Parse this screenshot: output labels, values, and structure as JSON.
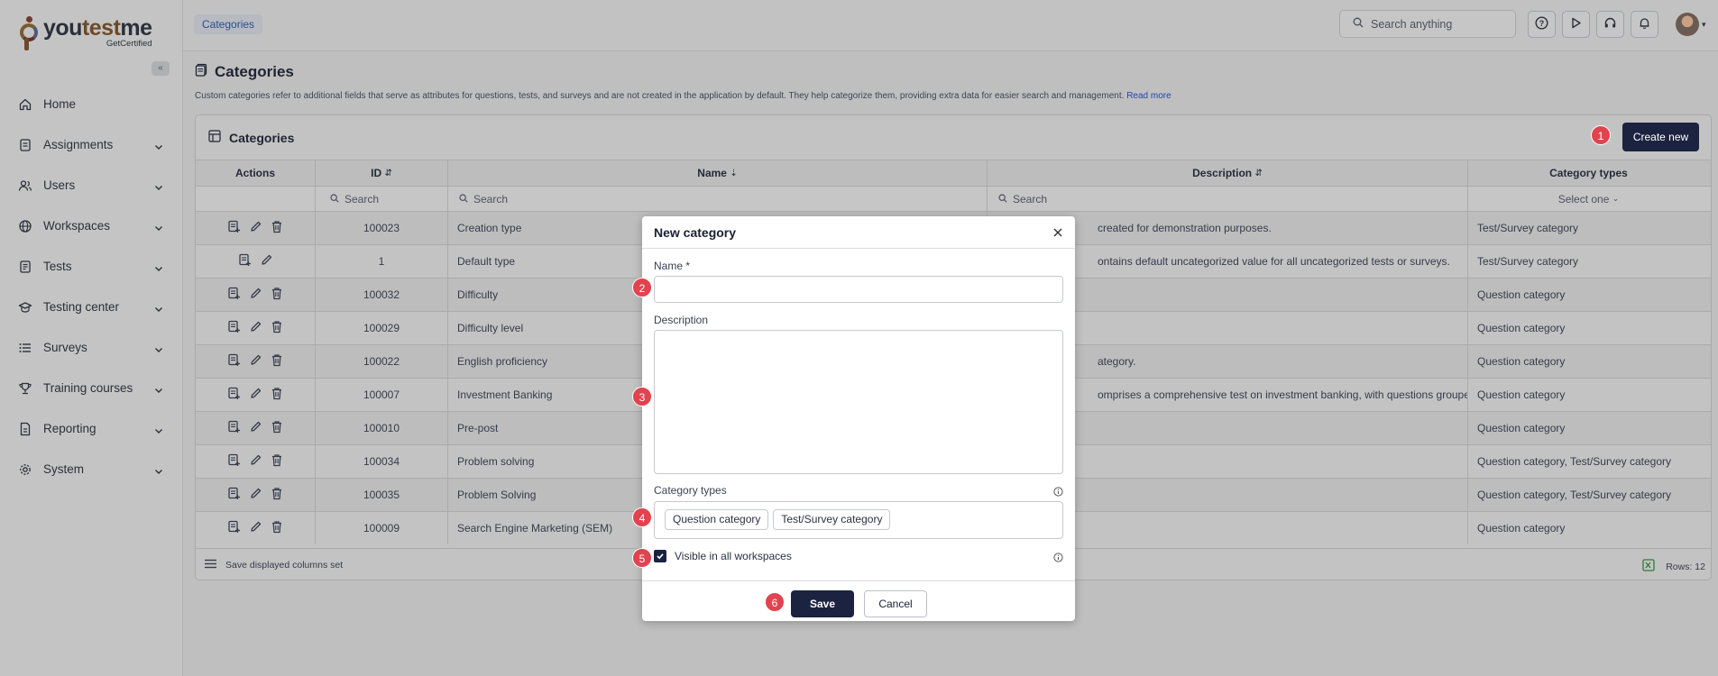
{
  "brand": {
    "name_you": "you",
    "name_test": "test",
    "name_me": "me",
    "tagline": "GetCertified",
    "collapse_glyph": "«"
  },
  "sidebar": {
    "items": [
      {
        "label": "Home",
        "icon": "home-icon",
        "expandable": false
      },
      {
        "label": "Assignments",
        "icon": "clipboard-icon",
        "expandable": true
      },
      {
        "label": "Users",
        "icon": "users-icon",
        "expandable": true
      },
      {
        "label": "Workspaces",
        "icon": "globe-icon",
        "expandable": true
      },
      {
        "label": "Tests",
        "icon": "test-icon",
        "expandable": true
      },
      {
        "label": "Testing center",
        "icon": "graduation-cap-icon",
        "expandable": true
      },
      {
        "label": "Surveys",
        "icon": "list-icon",
        "expandable": true
      },
      {
        "label": "Training courses",
        "icon": "trophy-icon",
        "expandable": true
      },
      {
        "label": "Reporting",
        "icon": "report-icon",
        "expandable": true
      },
      {
        "label": "System",
        "icon": "gear-icon",
        "expandable": true
      }
    ]
  },
  "topbar": {
    "breadcrumb": "Categories",
    "search_placeholder": "Search anything",
    "icons": [
      "help-icon",
      "play-icon",
      "headset-icon",
      "bell-icon"
    ]
  },
  "page": {
    "title": "Categories",
    "description": "Custom categories refer to additional fields that serve as attributes for questions, tests, and surveys and are not created in the application by default. They help categorize them, providing extra data for easier search and management.",
    "read_more": "Read more"
  },
  "card": {
    "title": "Categories",
    "create_button": "Create new",
    "columns": {
      "actions": "Actions",
      "id": "ID",
      "name": "Name",
      "description": "Description",
      "types": "Category types"
    },
    "filters": {
      "id": "Search",
      "name": "Search",
      "description": "Search",
      "types": "Select one"
    },
    "rows": [
      {
        "id": "100023",
        "name": "Creation type",
        "description": "created for demonstration purposes.",
        "desc_indent": "28",
        "types": "Test/Survey category",
        "delete": true
      },
      {
        "id": "1",
        "name": "Default type",
        "description": "ontains default uncategorized value for all uncategorized tests or surveys.",
        "desc_indent": "28",
        "types": "Test/Survey category",
        "delete": false
      },
      {
        "id": "100032",
        "name": "Difficulty",
        "description": "",
        "desc_indent": "0",
        "types": "Question category",
        "delete": true
      },
      {
        "id": "100029",
        "name": "Difficulty level",
        "description": "",
        "desc_indent": "0",
        "types": "Question category",
        "delete": true
      },
      {
        "id": "100022",
        "name": "English proficiency",
        "description": "ategory.",
        "desc_indent": "28",
        "types": "Question category",
        "delete": true
      },
      {
        "id": "100007",
        "name": "Investment Banking",
        "description": "omprises a comprehensive test on investment banking, with questions groupe...",
        "desc_indent": "28",
        "types": "Question category",
        "delete": true
      },
      {
        "id": "100010",
        "name": "Pre-post",
        "description": "",
        "desc_indent": "0",
        "types": "Question category",
        "delete": true
      },
      {
        "id": "100034",
        "name": "Problem solving",
        "description": "",
        "desc_indent": "0",
        "types": "Question category, Test/Survey category",
        "delete": true
      },
      {
        "id": "100035",
        "name": "Problem Solving",
        "description": "",
        "desc_indent": "0",
        "types": "Question category, Test/Survey category",
        "delete": true
      },
      {
        "id": "100009",
        "name": "Search Engine Marketing (SEM)",
        "description": "",
        "desc_indent": "0",
        "types": "Question category",
        "delete": true
      }
    ],
    "footer_label": "Save displayed columns set",
    "rows_count": "Rows: 12"
  },
  "modal": {
    "title": "New category",
    "name_label": "Name",
    "required_mark": "*",
    "name_value": "",
    "description_label": "Description",
    "description_value": "",
    "types_label": "Category types",
    "type_chips": [
      "Question category",
      "Test/Survey category"
    ],
    "visible_label": "Visible in all workspaces",
    "visible_checked": true,
    "save": "Save",
    "cancel": "Cancel"
  },
  "badges": [
    "1",
    "2",
    "3",
    "4",
    "5",
    "6"
  ],
  "colors": {
    "primary": "#1c2340",
    "link": "#2046a8",
    "badge": "#e1434f"
  }
}
